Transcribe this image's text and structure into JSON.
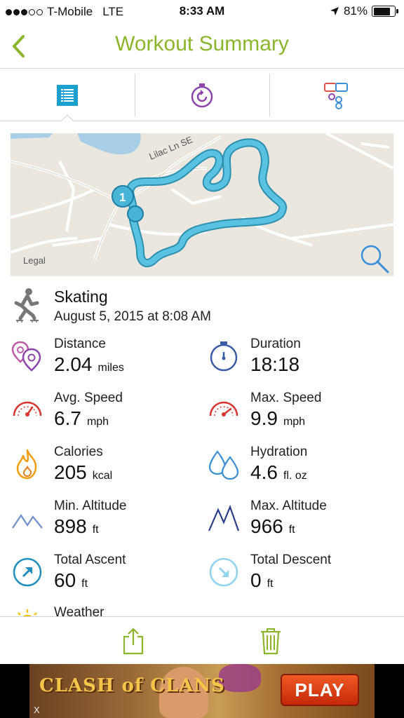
{
  "status_bar": {
    "carrier": "T-Mobile",
    "network": "LTE",
    "time": "8:33 AM",
    "battery": "81%",
    "battery_level": 0.81,
    "signal_bars_filled": 3,
    "signal_bars_total": 5
  },
  "header": {
    "title": "Workout Summary",
    "back_icon": "chevron-left-icon"
  },
  "tabs": [
    {
      "icon": "list-icon",
      "selected": true
    },
    {
      "icon": "stopwatch-icon",
      "selected": false
    },
    {
      "icon": "comments-icon",
      "selected": false
    }
  ],
  "map": {
    "street_label": "Lilac Ln SE",
    "marker_label": "1",
    "legal": "Legal"
  },
  "activity": {
    "name": "Skating",
    "date": "August 5, 2015 at 8:08 AM"
  },
  "stats": [
    {
      "label": "Distance",
      "value": "2.04",
      "unit": "miles",
      "icon": "location-pins-icon",
      "color": "#9b59b6"
    },
    {
      "label": "Duration",
      "value": "18:18",
      "unit": "",
      "icon": "stopwatch-icon",
      "color": "#3a5ba8"
    },
    {
      "label": "Avg. Speed",
      "value": "6.7",
      "unit": "mph",
      "icon": "speedometer-icon",
      "color": "#d8362e"
    },
    {
      "label": "Max. Speed",
      "value": "9.9",
      "unit": "mph",
      "icon": "speedometer-icon",
      "color": "#d8362e"
    },
    {
      "label": "Calories",
      "value": "205",
      "unit": "kcal",
      "icon": "flame-icon",
      "color": "#f39c12"
    },
    {
      "label": "Hydration",
      "value": "4.6",
      "unit": "fl. oz",
      "icon": "water-drops-icon",
      "color": "#3a8fd8"
    },
    {
      "label": "Min. Altitude",
      "value": "898",
      "unit": "ft",
      "icon": "mountain-low-icon",
      "color": "#5b7fc4"
    },
    {
      "label": "Max. Altitude",
      "value": "966",
      "unit": "ft",
      "icon": "mountain-high-icon",
      "color": "#2c3e8a"
    },
    {
      "label": "Total Ascent",
      "value": "60",
      "unit": "ft",
      "icon": "arrow-up-right-circle-icon",
      "color": "#1f8fc0"
    },
    {
      "label": "Total Descent",
      "value": "0",
      "unit": "ft",
      "icon": "arrow-down-right-circle-icon",
      "color": "#8fd3ec"
    }
  ],
  "weather": {
    "label": "Weather",
    "icon": "sun-icon"
  },
  "toolbar": {
    "share_icon": "share-icon",
    "delete_icon": "trash-icon"
  },
  "ad": {
    "brand": "CLASH of CLANS",
    "cta": "PLAY",
    "close": "X"
  },
  "colors": {
    "accent_green": "#8bb52a",
    "route_blue": "#3fb4d7",
    "divider": "#d4d4d4"
  }
}
